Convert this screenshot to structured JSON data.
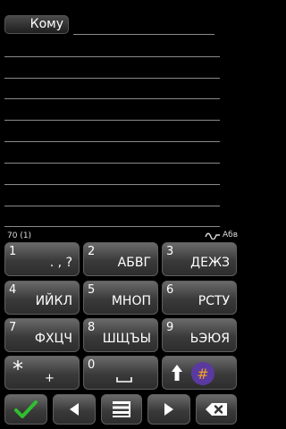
{
  "header": {
    "to_label": "Кому"
  },
  "status": {
    "char_counter": "70 (1)",
    "input_mode": "Абв"
  },
  "keypad": {
    "keys": [
      {
        "num": "1",
        "letters": ". , ?"
      },
      {
        "num": "2",
        "letters": "АБВГ"
      },
      {
        "num": "3",
        "letters": "ДЕЖЗ"
      },
      {
        "num": "4",
        "letters": "ИЙКЛ"
      },
      {
        "num": "5",
        "letters": "МНОП"
      },
      {
        "num": "6",
        "letters": "РСТУ"
      },
      {
        "num": "7",
        "letters": "ФХЦЧ"
      },
      {
        "num": "8",
        "letters": "ШЩЪЫ"
      },
      {
        "num": "9",
        "letters": "ЬЭЮЯ"
      }
    ],
    "star_key": {
      "symbol": "*",
      "secondary": "+"
    },
    "zero_key": {
      "num": "0"
    },
    "shift_key": {
      "icon": "shift-arrow-icon",
      "secondary": "#"
    }
  },
  "navbar": {
    "accept_icon": "checkmark-icon",
    "left_icon": "arrow-left-icon",
    "menu_icon": "menu-list-icon",
    "right_icon": "arrow-right-icon",
    "backspace_icon": "backspace-icon"
  },
  "colors": {
    "accept": "#2fbf2f",
    "shift_badge": "#5a3aa0",
    "badge_symbol": "#f0a020"
  }
}
